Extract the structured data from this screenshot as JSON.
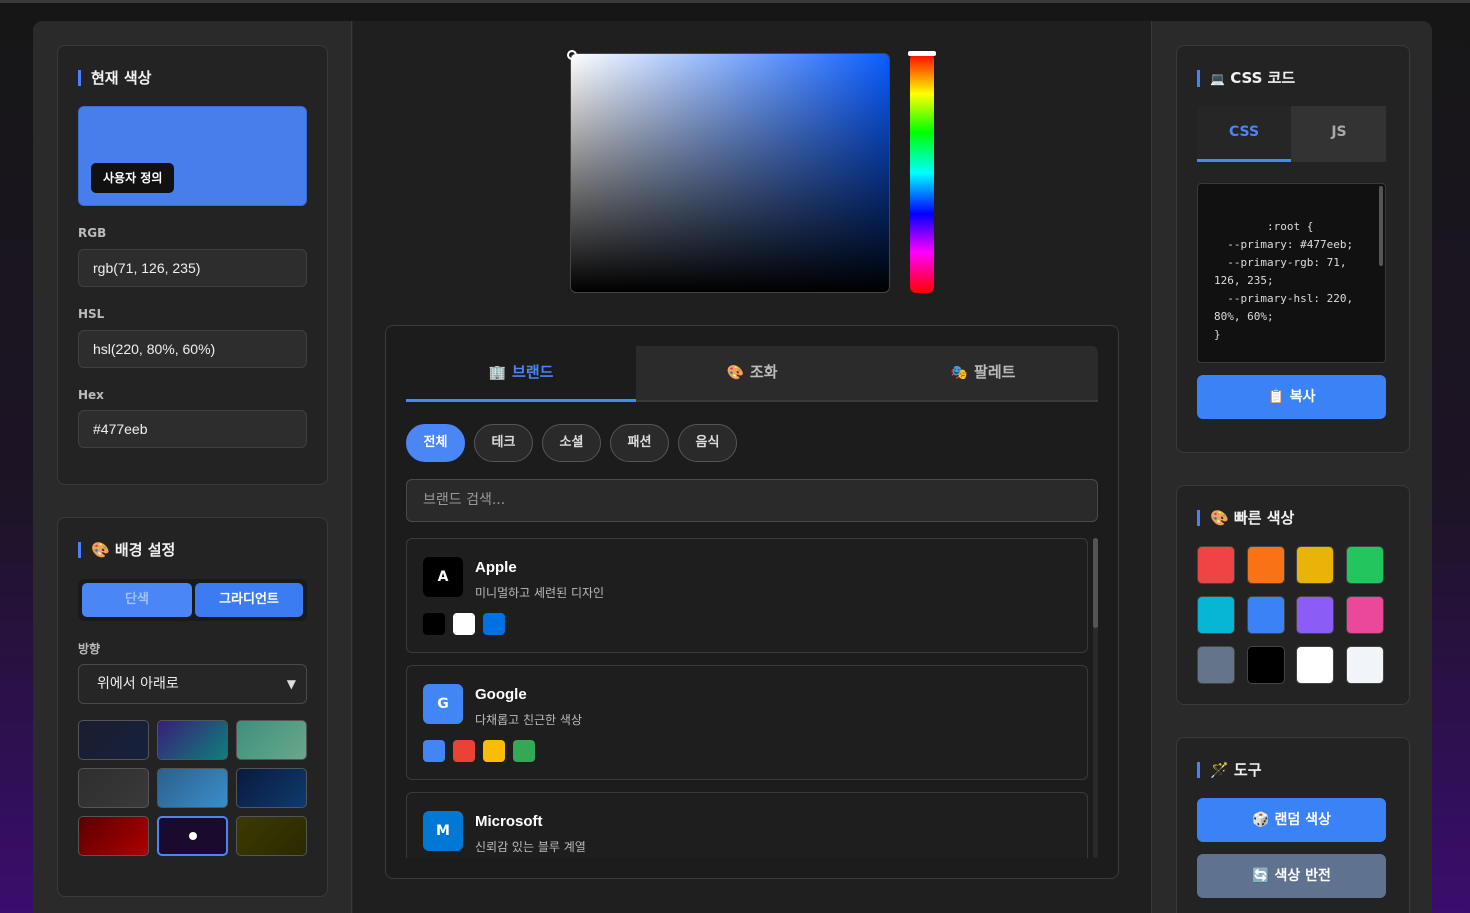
{
  "current_color": {
    "title": "현재 색상",
    "badge": "사용자 정의",
    "hex_value": "#477eeb",
    "fields": [
      {
        "label": "RGB",
        "value": "rgb(71, 126, 235)"
      },
      {
        "label": "HSL",
        "value": "hsl(220, 80%, 60%)"
      },
      {
        "label": "Hex",
        "value": "#477eeb"
      }
    ]
  },
  "background": {
    "icon": "palette-icon",
    "title": "배경 설정",
    "mode_solid": "단색",
    "mode_gradient": "그라디언트",
    "direction_label": "방향",
    "direction_value": "위에서 아래로",
    "presets": [
      {
        "from": "#1a1d2e",
        "to": "#16213e"
      },
      {
        "from": "#3a1d7a",
        "to": "#0f7f7a"
      },
      {
        "from": "#3d8f7f",
        "to": "#6aa88a"
      },
      {
        "from": "#2e2e2e",
        "to": "#3a3a3a"
      },
      {
        "from": "#2d5f8a",
        "to": "#3a8ec9"
      },
      {
        "from": "#0a1a3d",
        "to": "#0e3a6e"
      },
      {
        "from": "#5a0000",
        "to": "#b00000"
      },
      {
        "from": "#1a0a2e",
        "to": "#1a0a2e",
        "selected": true
      },
      {
        "from": "#3d3a00",
        "to": "#2a2a00"
      }
    ]
  },
  "picker": {
    "hue_color": "#0a5cff"
  },
  "brand_panel": {
    "tabs": [
      {
        "icon": "building-icon",
        "label": "브랜드",
        "active": true
      },
      {
        "icon": "palette-icon",
        "label": "조화",
        "active": false
      },
      {
        "icon": "theater-masks-icon",
        "label": "팔레트",
        "active": false
      }
    ],
    "categories": [
      "전체",
      "테크",
      "소셜",
      "패션",
      "음식"
    ],
    "active_category": "전체",
    "search_placeholder": "브랜드 검색...",
    "brands": [
      {
        "letter": "A",
        "name": "Apple",
        "desc": "미니멀하고 세련된 디자인",
        "logo_color": "#000000",
        "colors": [
          "#000000",
          "#ffffff",
          "#0071e3"
        ]
      },
      {
        "letter": "G",
        "name": "Google",
        "desc": "다채롭고 친근한 색상",
        "logo_color": "#4285f4",
        "colors": [
          "#4285f4",
          "#ea4335",
          "#fbbc05",
          "#34a853"
        ]
      },
      {
        "letter": "M",
        "name": "Microsoft",
        "desc": "신뢰감 있는 블루 계열",
        "logo_color": "#0078d4",
        "colors": []
      }
    ]
  },
  "css_code": {
    "icon": "laptop-icon",
    "title": "CSS 코드",
    "tabs": [
      "CSS",
      "JS"
    ],
    "active_tab": "CSS",
    "code": ":root {\n  --primary: #477eeb;\n  --primary-rgb: 71,\n126, 235;\n  --primary-hsl: 220,\n80%, 60%;\n}\n\nbody {",
    "copy_label": "복사",
    "copy_icon": "clipboard-icon"
  },
  "quick_colors": {
    "icon": "palette-icon",
    "title": "빠른 색상",
    "colors": [
      "#ef4444",
      "#f97316",
      "#eab308",
      "#22c55e",
      "#06b6d4",
      "#3b82f6",
      "#8b5cf6",
      "#ec4899",
      "#64748b",
      "#000000",
      "#ffffff",
      "#f1f5f9"
    ]
  },
  "tools": {
    "icon": "wand-icon",
    "title": "도구",
    "random_label": "랜덤 색상",
    "random_icon": "dice-icon",
    "invert_label": "색상 반전",
    "invert_icon": "refresh-icon"
  }
}
